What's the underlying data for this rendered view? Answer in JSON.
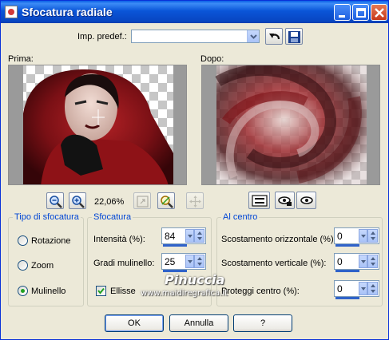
{
  "window": {
    "title": "Sfocatura radiale"
  },
  "preset": {
    "label": "Imp. predef.:",
    "value": ""
  },
  "preview": {
    "before_label": "Prima:",
    "after_label": "Dopo:",
    "zoom": "22,06%"
  },
  "blur_type": {
    "legend": "Tipo di sfocatura",
    "options": [
      "Rotazione",
      "Zoom",
      "Mulinello"
    ],
    "selected": "Mulinello"
  },
  "blur": {
    "legend": "Sfocatura",
    "intensity_label": "Intensità (%):",
    "intensity_value": "84",
    "twist_label": "Gradi mulinello:",
    "twist_value": "25",
    "ellipse_label": "Ellisse",
    "ellipse_checked": true
  },
  "center": {
    "legend": "Al centro",
    "h_offset_label": "Scostamento orizzontale (%):",
    "h_offset_value": "0",
    "v_offset_label": "Scostamento verticale (%):",
    "v_offset_value": "0",
    "protect_label": "Proteggi centro (%):",
    "protect_value": "0"
  },
  "buttons": {
    "ok": "OK",
    "cancel": "Annulla",
    "help": "?"
  },
  "watermark": {
    "name": "Pinuccia",
    "site": "www.maidiregrafica.it"
  },
  "colors": {
    "title_bar": "#0a55d8",
    "group_legend": "#0046d5",
    "dialog_bg": "#ece9d8"
  }
}
